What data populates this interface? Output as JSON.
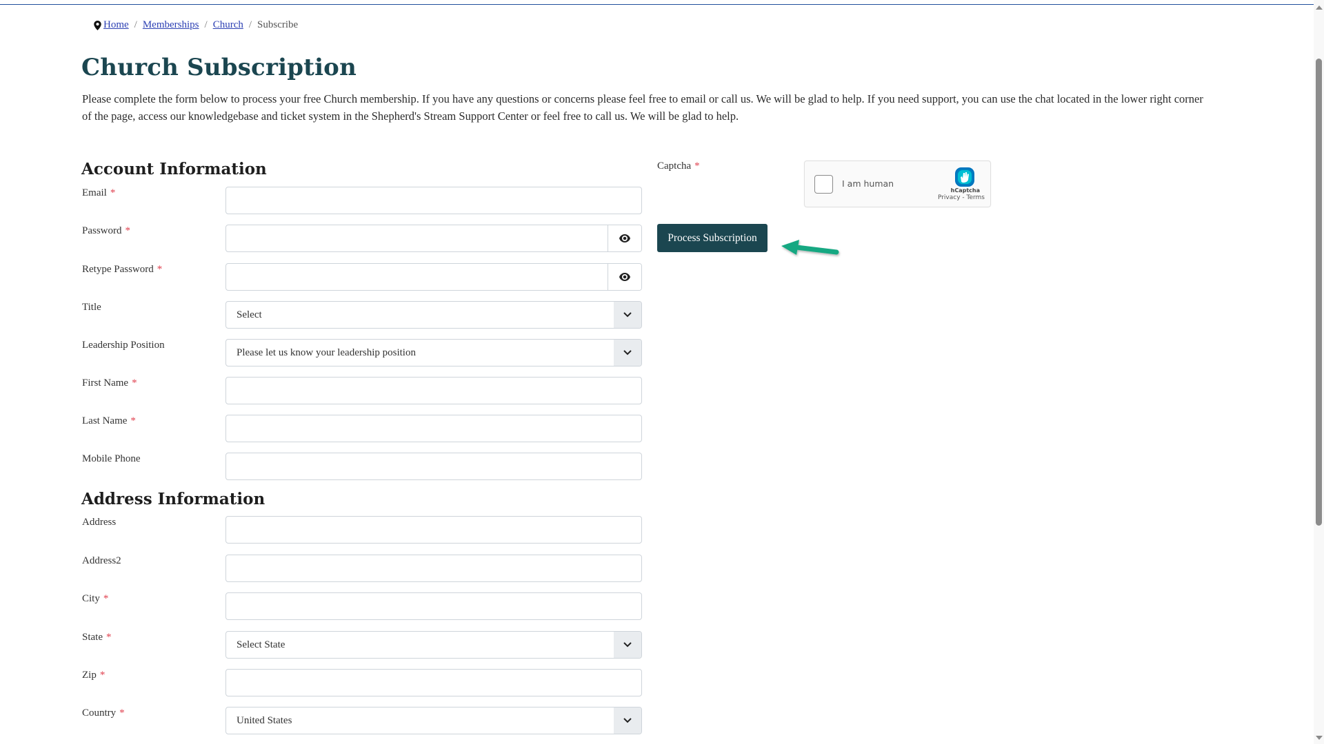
{
  "breadcrumb": {
    "items": [
      {
        "label": "Home",
        "link": true
      },
      {
        "label": "Memberships",
        "link": true
      },
      {
        "label": "Church",
        "link": true
      },
      {
        "label": "Subscribe",
        "link": false
      }
    ],
    "separator": "/"
  },
  "page": {
    "title": "Church Subscription",
    "intro": "Please complete the form below to process your free Church membership. If you have any questions or concerns please feel free to email or call us. We will be glad to help. If you need support, you can use the chat located in the lower right corner of the page, access our knowledgebase and ticket system in the Shepherd's Stream Support Center or feel free to call us. We will be glad to help."
  },
  "account_section": {
    "heading": "Account Information",
    "fields": {
      "email": {
        "label": "Email",
        "required": "*",
        "value": ""
      },
      "password": {
        "label": "Password",
        "required": "*",
        "value": ""
      },
      "retype_password": {
        "label": "Retype Password",
        "required": "*",
        "value": ""
      },
      "title": {
        "label": "Title",
        "selected": "Select"
      },
      "leadership_position": {
        "label": "Leadership Position",
        "selected": "Please let us know your leadership position"
      },
      "first_name": {
        "label": "First Name",
        "required": "*",
        "value": ""
      },
      "last_name": {
        "label": "Last Name",
        "required": "*",
        "value": ""
      },
      "mobile_phone": {
        "label": "Mobile Phone",
        "value": ""
      }
    }
  },
  "address_section": {
    "heading": "Address Information",
    "fields": {
      "address": {
        "label": "Address",
        "value": ""
      },
      "address2": {
        "label": "Address2",
        "value": ""
      },
      "city": {
        "label": "City",
        "required": "*",
        "value": ""
      },
      "state": {
        "label": "State",
        "required": "*",
        "selected": "Select State"
      },
      "zip": {
        "label": "Zip",
        "required": "*",
        "value": ""
      },
      "country": {
        "label": "Country",
        "required": "*",
        "selected": "United States"
      }
    }
  },
  "captcha": {
    "label": "Captcha",
    "required": "*",
    "checkbox_text": "I am human",
    "brand": "hCaptcha",
    "links": "Privacy - Terms"
  },
  "actions": {
    "submit_label": "Process Subscription"
  },
  "icons": {
    "breadcrumb": "map-pin-icon",
    "password_toggle": "eye-icon",
    "select": "chevron-down-icon",
    "annotation": "arrow-left-icon"
  },
  "colors": {
    "brand": "#1b4650",
    "link": "#2b3fb3",
    "required": "#e0414f",
    "annotation_arrow": "#17a882",
    "top_border": "#1f4e9c"
  }
}
